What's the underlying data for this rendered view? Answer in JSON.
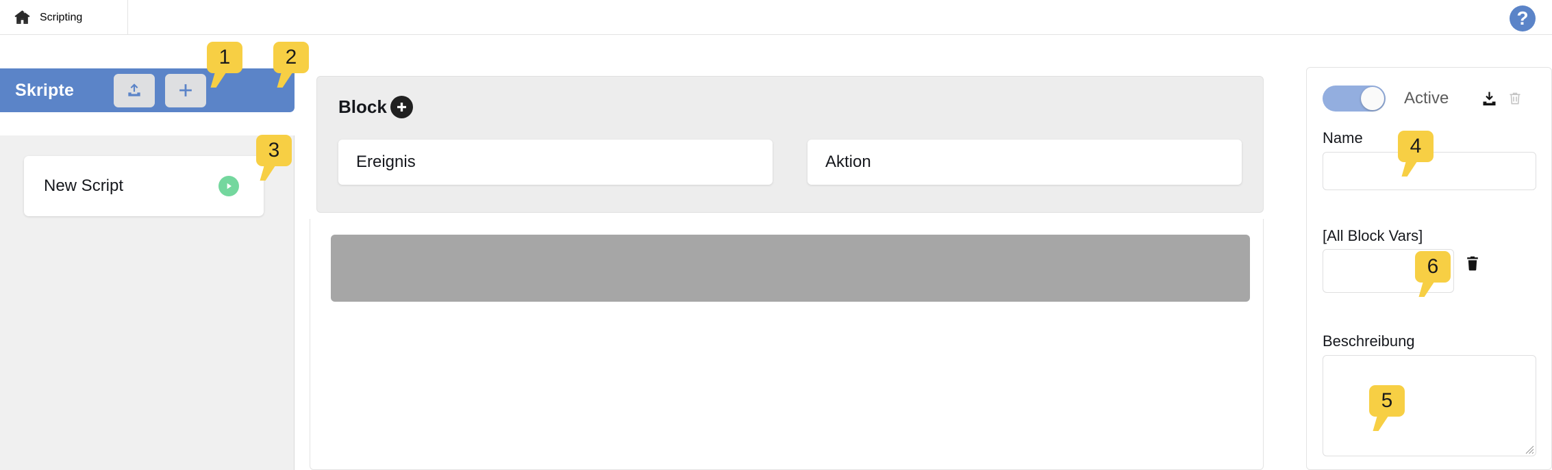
{
  "topbar": {
    "home_icon": "home-icon",
    "breadcrumb_label": "Scripting",
    "help_icon_glyph": "?",
    "help_icon_name": "question-mark-icon",
    "help_icon_color": "#5b84c8"
  },
  "scripts_panel": {
    "title": "Skripte",
    "header_color": "#5b84c8",
    "upload_button_icon": "upload-icon",
    "add_button_icon": "plus-icon",
    "items": [
      {
        "label": "New Script",
        "run_icon": "play-icon",
        "run_icon_color": "#74d79e"
      }
    ]
  },
  "block_editor": {
    "title": "Block",
    "add_block_icon": "plus-circle-icon",
    "slots": [
      {
        "label": "Ereignis"
      },
      {
        "label": "Aktion"
      }
    ],
    "canvas_placeholder_color": "#a6a6a6"
  },
  "properties_panel": {
    "active_toggle": {
      "label": "Active",
      "state": "on",
      "on_color": "#93aedf"
    },
    "download_icon": "download-icon",
    "delete_script_icon": "trash-icon",
    "name": {
      "label": "Name",
      "value": "",
      "placeholder": ""
    },
    "block_vars": {
      "label": "[All Block Vars]",
      "value": "",
      "chevron_icon": "chevron-down-icon",
      "delete_icon": "trash-icon"
    },
    "description": {
      "label": "Beschreibung",
      "value": "",
      "placeholder": "",
      "resize_handle_icon": "resize-handle-icon"
    }
  },
  "callouts": [
    {
      "id": 1,
      "number": "1"
    },
    {
      "id": 2,
      "number": "2"
    },
    {
      "id": 3,
      "number": "3"
    },
    {
      "id": 4,
      "number": "4"
    },
    {
      "id": 5,
      "number": "5"
    },
    {
      "id": 6,
      "number": "6"
    }
  ],
  "callout_color": "#f7cf44"
}
